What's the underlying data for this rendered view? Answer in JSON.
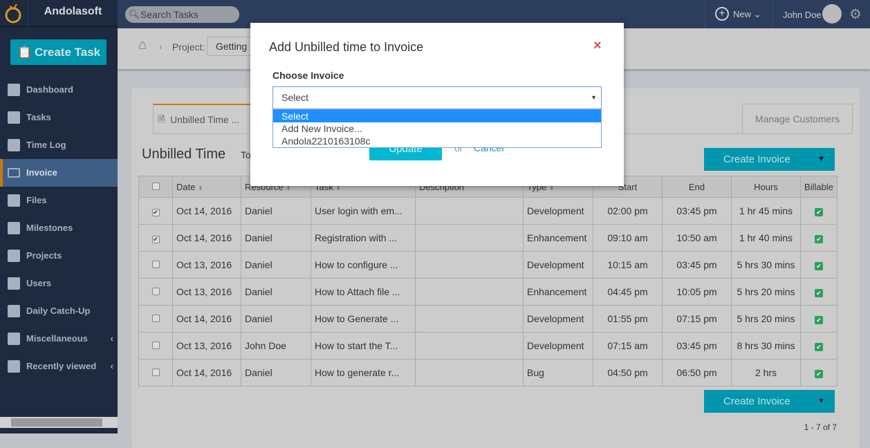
{
  "app": {
    "brand": "Andolasoft",
    "create_task": "Create Task"
  },
  "sidebar": {
    "items": [
      {
        "label": "Dashboard",
        "icon": "dashboard-icon"
      },
      {
        "label": "Tasks",
        "icon": "tasks-icon"
      },
      {
        "label": "Time Log",
        "icon": "clock-icon"
      },
      {
        "label": "Invoice",
        "icon": "invoice-icon",
        "active": true
      },
      {
        "label": "Files",
        "icon": "paperclip-icon"
      },
      {
        "label": "Milestones",
        "icon": "grid-icon"
      },
      {
        "label": "Projects",
        "icon": "briefcase-icon"
      },
      {
        "label": "Users",
        "icon": "user-icon"
      },
      {
        "label": "Daily Catch-Up",
        "icon": "bell-icon"
      },
      {
        "label": "Miscellaneous",
        "icon": "layers-icon",
        "chevron": "‹"
      },
      {
        "label": "Recently viewed",
        "icon": "eye-icon",
        "chevron": "‹"
      }
    ]
  },
  "header": {
    "search_placeholder": "Search Tasks",
    "new_label": "New",
    "user_name": "John Doe"
  },
  "breadcrumb": {
    "project_label": "Project:",
    "project_value": "Getting"
  },
  "tabs": {
    "unbilled": "Unbilled Time ...",
    "manage_customers": "Manage Customers"
  },
  "main": {
    "title": "Unbilled Time",
    "to_text": "To",
    "create_invoice": "Create Invoice",
    "pager": "1 - 7 of 7"
  },
  "table": {
    "headers": [
      "Date",
      "Resource",
      "Task",
      "Description",
      "Type",
      "Start",
      "End",
      "Hours",
      "Billable"
    ],
    "rows": [
      {
        "checked": true,
        "date": "Oct 14, 2016",
        "resource": "Daniel",
        "task": "User login with em...",
        "description": "",
        "type": "Development",
        "start": "02:00 pm",
        "end": "03:45 pm",
        "hours": "1 hr 45 mins",
        "billable": true
      },
      {
        "checked": true,
        "date": "Oct 14, 2016",
        "resource": "Daniel",
        "task": "Registration with ...",
        "description": "",
        "type": "Enhancement",
        "start": "09:10 am",
        "end": "10:50 am",
        "hours": "1 hr 40 mins",
        "billable": true
      },
      {
        "checked": false,
        "date": "Oct 13, 2016",
        "resource": "Daniel",
        "task": "How to configure ...",
        "description": "",
        "type": "Development",
        "start": "10:15 am",
        "end": "03:45 pm",
        "hours": "5 hrs 30 mins",
        "billable": true
      },
      {
        "checked": false,
        "date": "Oct 13, 2016",
        "resource": "Daniel",
        "task": "How to Attach file ...",
        "description": "",
        "type": "Enhancement",
        "start": "04:45 pm",
        "end": "10:05 pm",
        "hours": "5 hrs 20 mins",
        "billable": true
      },
      {
        "checked": false,
        "date": "Oct 14, 2016",
        "resource": "Daniel",
        "task": "How to Generate ...",
        "description": "",
        "type": "Development",
        "start": "01:55 pm",
        "end": "07:15 pm",
        "hours": "5 hrs 20 mins",
        "billable": true
      },
      {
        "checked": false,
        "date": "Oct 13, 2016",
        "resource": "John Doe",
        "task": "How to start the T...",
        "description": "",
        "type": "Development",
        "start": "07:15 am",
        "end": "03:45 pm",
        "hours": "8 hrs 30 mins",
        "billable": true
      },
      {
        "checked": false,
        "date": "Oct 14, 2016",
        "resource": "Daniel",
        "task": "How to generate r...",
        "description": "",
        "type": "Bug",
        "start": "04:50 pm",
        "end": "06:50 pm",
        "hours": "2 hrs",
        "billable": true
      }
    ]
  },
  "modal": {
    "title": "Add Unbilled time to Invoice",
    "close": "×",
    "label": "Choose Invoice",
    "selected": "Select",
    "options": [
      "Select",
      "Add New Invoice...",
      "Andola2210163108c"
    ],
    "update": "Update",
    "or": "or",
    "cancel": "Cancel"
  },
  "colors": {
    "accent": "#0096ad",
    "sidebar": "#1d2a3f",
    "active_bar": "#c77a0c",
    "option_highlight": "#1e90ff"
  }
}
